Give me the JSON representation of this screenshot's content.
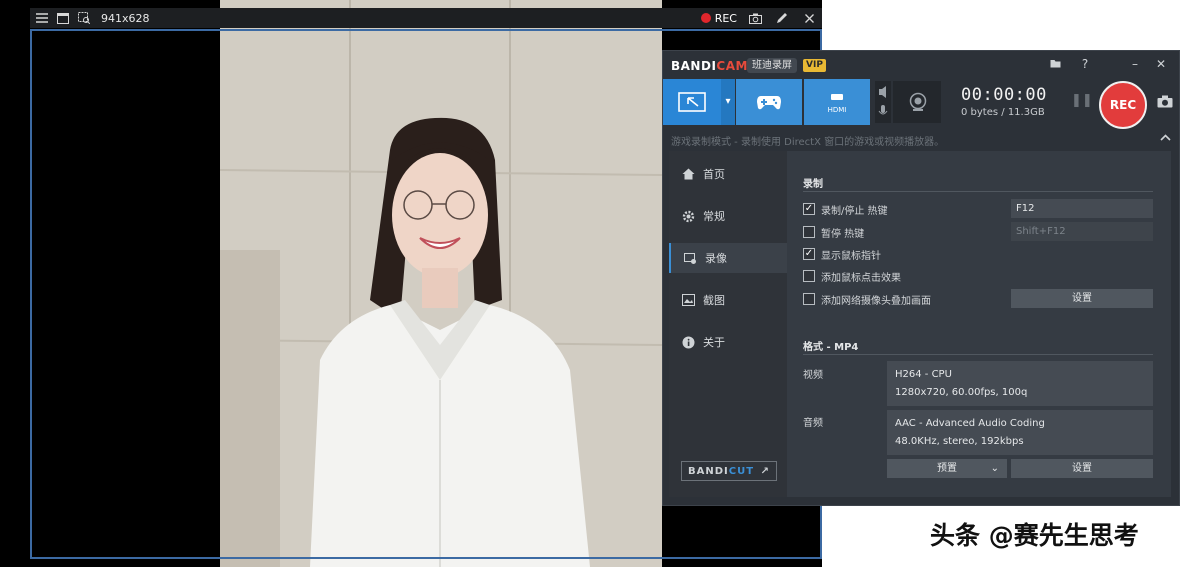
{
  "capture_toolbar": {
    "size_label": "941x628",
    "rec_label": "REC"
  },
  "bandicam": {
    "logo_part1": "BANDI",
    "logo_part2": "CAM",
    "brand_cn": "班迪录屏",
    "vip_badge": "VIP",
    "window_buttons": [
      "folder-icon",
      "help-icon",
      "minimize-icon",
      "close-icon"
    ],
    "toolbar": {
      "modes": [
        "screen-mode-icon",
        "game-mode-icon",
        "hdmi-mode-icon"
      ],
      "hdmi_label": "HDMI",
      "timer": "00:00:00",
      "file_size": "0 bytes / 11.3GB",
      "rec_label": "REC"
    },
    "hint": "游戏录制模式 - 录制使用 DirectX 窗口的游戏或视频播放器。",
    "sidebar": {
      "items": [
        {
          "label": "首页",
          "icon": "home-icon"
        },
        {
          "label": "常规",
          "icon": "gear-icon"
        },
        {
          "label": "录像",
          "icon": "video-settings-icon"
        },
        {
          "label": "截图",
          "icon": "image-icon"
        },
        {
          "label": "关于",
          "icon": "info-icon"
        }
      ],
      "active_index": 2,
      "bandicut_part1": "BANDI",
      "bandicut_part2": "CUT",
      "bandicut_arrow": "↗"
    },
    "record_section": {
      "title": "录制",
      "options": [
        {
          "label": "录制/停止 热键",
          "checked": true
        },
        {
          "label": "暂停 热键",
          "checked": false
        },
        {
          "label": "显示鼠标指针",
          "checked": true
        },
        {
          "label": "添加鼠标点击效果",
          "checked": false
        },
        {
          "label": "添加网络摄像头叠加画面",
          "checked": false
        }
      ],
      "hotkey_record": "F12",
      "hotkey_pause": "Shift+F12",
      "webcam_settings_button": "设置"
    },
    "format_section": {
      "title": "格式 - MP4",
      "video_label": "视频",
      "video_codec": "H264 - CPU",
      "video_details": "1280x720, 60.00fps, 100q",
      "audio_label": "音频",
      "audio_codec": "AAC - Advanced Audio Coding",
      "audio_details": "48.0KHz, stereo, 192kbps",
      "preset_button": "预置",
      "settings_button": "设置"
    }
  },
  "watermark": "头条 @赛先生思考",
  "colors": {
    "accent_blue": "#3a8fd6",
    "rec_red": "#e23c3c",
    "panel_bg": "#2c3138",
    "capture_border": "#3c6aa3"
  }
}
